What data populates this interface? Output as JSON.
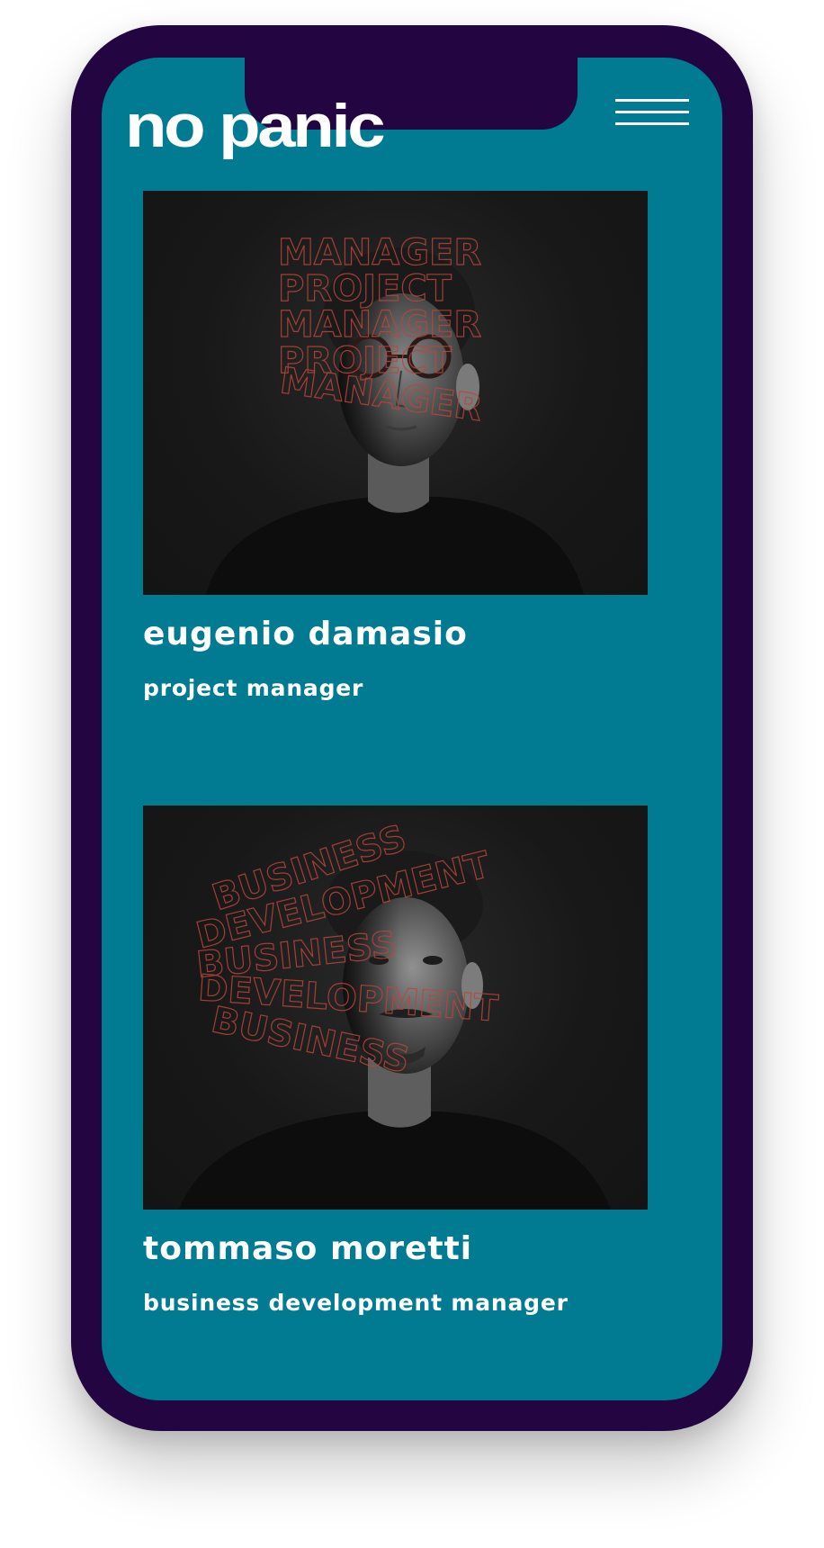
{
  "brand": {
    "logo_text": "no panic"
  },
  "header": {
    "menu_icon": "hamburger-menu-icon"
  },
  "colors": {
    "frame": "#220541",
    "screen_background": "#007b91",
    "text": "#ffffff",
    "photo_background": "#161616",
    "overlay_text": "#b8473b"
  },
  "team": [
    {
      "name": "eugenio damasio",
      "role": "project manager",
      "overlay_words": [
        "MANAGER",
        "PROJECT",
        "MANAGER",
        "PROJECT",
        "MANAGER"
      ]
    },
    {
      "name": "tommaso moretti",
      "role": "business development manager",
      "overlay_words": [
        "BUSINESS",
        "DEVELOPMENT",
        "BUSINESS",
        "DEVELOPMENT",
        "BUSINESS"
      ]
    }
  ]
}
